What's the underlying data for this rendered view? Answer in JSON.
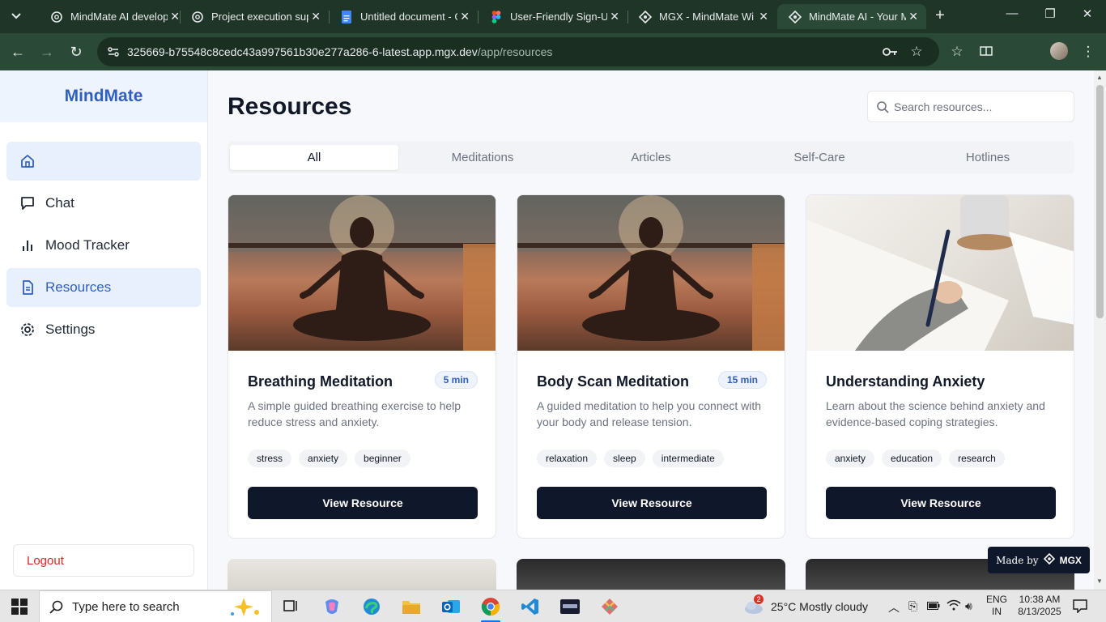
{
  "browser": {
    "tabs": [
      {
        "title": "MindMate AI develop",
        "icon": "openai-icon"
      },
      {
        "title": "Project execution sup",
        "icon": "openai-icon"
      },
      {
        "title": "Untitled document - G",
        "icon": "google-docs-icon"
      },
      {
        "title": "User-Friendly Sign-Up",
        "icon": "figma-icon"
      },
      {
        "title": "MGX - MindMate Wi",
        "icon": "mgx-icon"
      },
      {
        "title": "MindMate AI - Your M",
        "icon": "mgx-icon"
      }
    ],
    "url_host": "325669-b75548c8cedc43a997561b30e277a286-6-latest.app.mgx.dev",
    "url_path": "/app/resources"
  },
  "sidebar": {
    "brand": "MindMate",
    "items": [
      {
        "label": "",
        "icon": "home-icon"
      },
      {
        "label": "Chat",
        "icon": "chat-icon"
      },
      {
        "label": "Mood Tracker",
        "icon": "bar-chart-icon"
      },
      {
        "label": "Resources",
        "icon": "document-icon"
      },
      {
        "label": "Settings",
        "icon": "gear-icon"
      }
    ],
    "logout": "Logout"
  },
  "main": {
    "title": "Resources",
    "search_placeholder": "Search resources...",
    "tabs": [
      "All",
      "Meditations",
      "Articles",
      "Self-Care",
      "Hotlines"
    ],
    "active_tab": "All",
    "cards": [
      {
        "title": "Breathing Meditation",
        "duration": "5 min",
        "description": "A simple guided breathing exercise to help reduce stress and anxiety.",
        "tags": [
          "stress",
          "anxiety",
          "beginner"
        ],
        "button": "View Resource"
      },
      {
        "title": "Body Scan Meditation",
        "duration": "15 min",
        "description": "A guided meditation to help you connect with your body and release tension.",
        "tags": [
          "relaxation",
          "sleep",
          "intermediate"
        ],
        "button": "View Resource"
      },
      {
        "title": "Understanding Anxiety",
        "duration": "",
        "description": "Learn about the science behind anxiety and evidence-based coping strategies.",
        "tags": [
          "anxiety",
          "education",
          "research"
        ],
        "button": "View Resource"
      }
    ],
    "made_by": "Made by",
    "made_by_brand": "MGX"
  },
  "taskbar": {
    "search_placeholder": "Type here to search",
    "weather_badge": "2",
    "weather": "25°C  Mostly cloudy",
    "lang_top": "ENG",
    "lang_bottom": "IN",
    "time": "10:38 AM",
    "date": "8/13/2025"
  },
  "colors": {
    "brand": "#2f5fbf",
    "chrome": "#2a4a37",
    "button_dark": "#0f172a",
    "logout": "#dc2626"
  }
}
